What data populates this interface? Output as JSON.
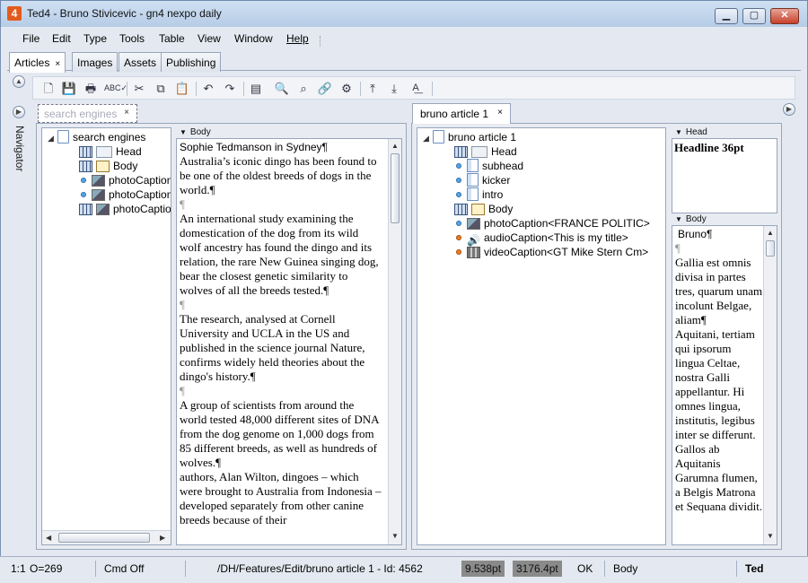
{
  "window": {
    "title": "Ted4 - Bruno Stivicevic - gn4 nexpo daily",
    "app_icon": "4"
  },
  "menu": [
    "File",
    "Edit",
    "Type",
    "Tools",
    "Table",
    "View",
    "Window",
    "Help"
  ],
  "top_tabs": [
    {
      "label": "Articles",
      "close": "×"
    },
    {
      "label": "Images"
    },
    {
      "label": "Assets"
    },
    {
      "label": "Publishing"
    }
  ],
  "navigator_label": "Navigator",
  "toolbar_icons": [
    "new-document-icon",
    "save-icon",
    "print-icon",
    "spellcheck-icon",
    "cut-icon",
    "copy-icon",
    "paste-icon",
    "undo-icon",
    "redo-icon",
    "layout-icon",
    "find-icon",
    "find-replace-icon",
    "link-icon",
    "settings-icon",
    "insert-above-icon",
    "insert-below-icon",
    "text-style-icon"
  ],
  "left_panel": {
    "tab_label": "search engines",
    "tab_close": "×",
    "tree": [
      {
        "label": "search engines",
        "icon": "document",
        "expander": "◢"
      },
      {
        "label": "Head",
        "icon": "field"
      },
      {
        "label": "Body",
        "icon": "pen"
      },
      {
        "label": "photoCaption",
        "icon": "photo",
        "dot": "blue"
      },
      {
        "label": "photoCaption",
        "icon": "photo",
        "dot": "blue"
      },
      {
        "label": "photoCaption",
        "icon": "photo"
      }
    ],
    "body_section": "Body",
    "body_paragraphs": [
      "Sophie Tedmanson in Sydney¶",
      "Australia’s iconic dingo has been found to be one of the oldest breeds of dogs in the world.¶",
      "¶",
      "An international study examining the domestication of the dog from its wild wolf ancestry has found the dingo and its relation, the rare New Guinea singing dog, bear the closest genetic similarity to wolves of all the breeds tested.¶",
      "¶",
      "The research, analysed at Cornell University and UCLA in the US and published in the science journal Nature, confirms widely held theories about the dingo's history.¶",
      "¶",
      "A group of scientists from around the world tested 48,000 different sites of DNA from the dog genome on 1,000 dogs from 85 different breeds, as well as hundreds of wolves.¶",
      "authors, Alan Wilton, dingoes – which were brought to Australia from Indonesia – developed separately from other canine breeds because of their"
    ]
  },
  "right_panel": {
    "tab_label": "bruno article 1",
    "tab_close": "×",
    "tree": [
      {
        "label": "bruno article 1",
        "icon": "document",
        "expander": "◢"
      },
      {
        "label": "Head",
        "icon": "field"
      },
      {
        "label": "subhead",
        "icon": "bar",
        "dot": "blue"
      },
      {
        "label": "kicker",
        "icon": "bar",
        "dot": "blue"
      },
      {
        "label": "intro",
        "icon": "bar",
        "dot": "blue"
      },
      {
        "label": "Body",
        "icon": "pen"
      },
      {
        "label": "photoCaption<FRANCE POLITIC>",
        "icon": "photo",
        "dot": "blue"
      },
      {
        "label": "audioCaption<This is my title>",
        "icon": "speaker",
        "dot": "orange"
      },
      {
        "label": "videoCaption<GT Mike Stern Cm>",
        "icon": "film",
        "dot": "orange"
      }
    ],
    "head_section": "Head",
    "head_text": "Headline 36pt",
    "body_section": "Body",
    "body_first_line": "Bruno¶",
    "body_paragraphs": [
      "¶",
      "Gallia est omnis divisa in partes tres, quarum unam incolunt Belgae, aliam¶",
      " Aquitani, tertiam qui ipsorum lingua Celtae, nostra Galli appellantur. Hi omnes lingua, institutis, legibus inter se differunt. Gallos ab Aquitanis Garumna flumen, a Belgis Matrona et Sequana dividit."
    ]
  },
  "status": {
    "position": "1:1",
    "offset": "O=269",
    "cmd": "Cmd Off",
    "path": "/DH/Features/Edit/bruno article 1 - Id: 4562",
    "size1": "9.538pt",
    "size2": "3176.4pt",
    "ok": "OK",
    "style": "Body",
    "app": "Ted"
  }
}
